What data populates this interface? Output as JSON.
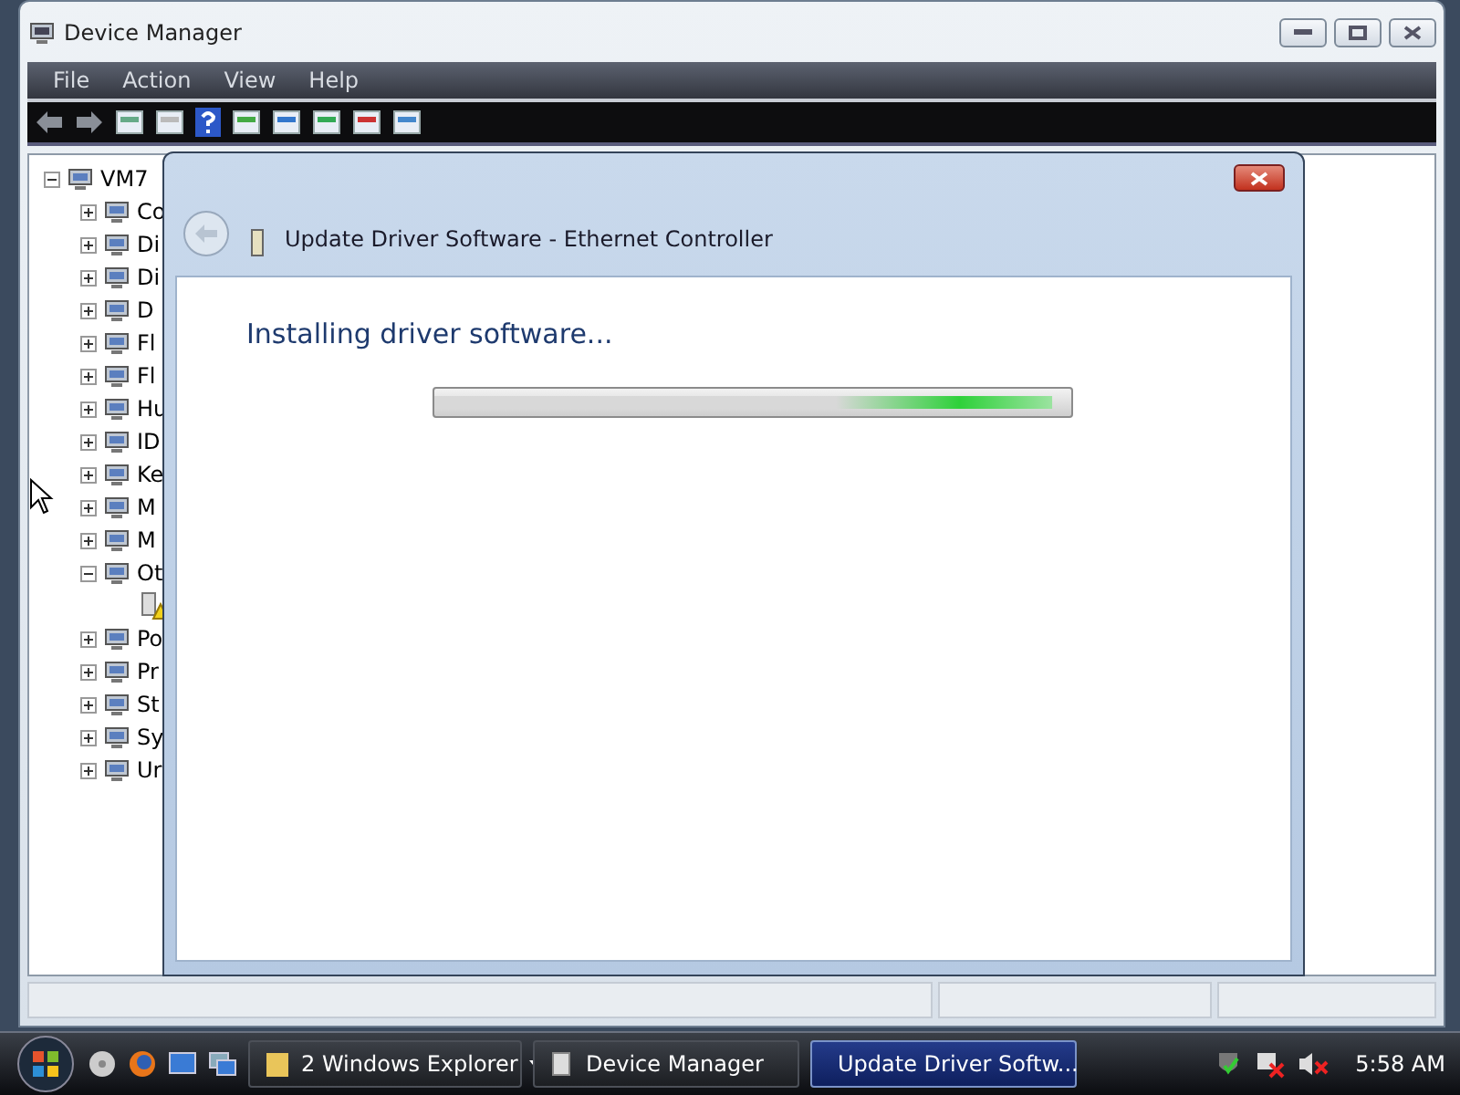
{
  "window": {
    "title": "Device Manager"
  },
  "menu": [
    "File",
    "Action",
    "View",
    "Help"
  ],
  "tree": {
    "label": "VM7",
    "expanded": true,
    "children": [
      {
        "label": "Co",
        "expanded": false
      },
      {
        "label": "Di",
        "expanded": false
      },
      {
        "label": "Di",
        "expanded": false
      },
      {
        "label": "D",
        "expanded": false
      },
      {
        "label": "Fl",
        "expanded": false
      },
      {
        "label": "Fl",
        "expanded": false
      },
      {
        "label": "Hu",
        "expanded": false
      },
      {
        "label": "ID",
        "expanded": false
      },
      {
        "label": "Ke",
        "expanded": false
      },
      {
        "label": "M",
        "expanded": false
      },
      {
        "label": "M",
        "expanded": false
      },
      {
        "label": "Ot",
        "expanded": true,
        "children": [
          {
            "kind": "warning"
          }
        ]
      },
      {
        "label": "Po",
        "expanded": false
      },
      {
        "label": "Pr",
        "expanded": false
      },
      {
        "label": "St",
        "expanded": false
      },
      {
        "label": "Sy",
        "expanded": false
      },
      {
        "label": "Ur",
        "expanded": false
      }
    ]
  },
  "dialog": {
    "title": "Update Driver Software - Ethernet Controller",
    "heading": "Installing driver software...",
    "progress": {
      "level": 0.97
    }
  },
  "taskbar": {
    "buttons": [
      {
        "label": "2 Windows Explorer",
        "selected": false,
        "kind": "group"
      },
      {
        "label": "Device Manager",
        "selected": false,
        "kind": "window"
      },
      {
        "label": "Update Driver Softw...",
        "selected": true,
        "kind": "window"
      }
    ],
    "clock": "5:58 AM"
  }
}
